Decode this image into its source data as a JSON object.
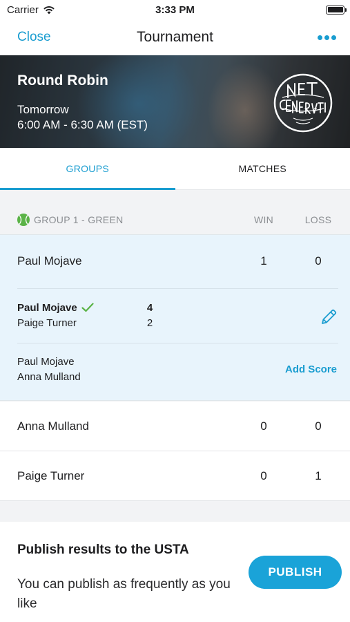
{
  "status_bar": {
    "carrier": "Carrier",
    "time": "3:33 PM"
  },
  "nav": {
    "close_label": "Close",
    "title": "Tournament"
  },
  "event": {
    "name": "Round Robin",
    "date": "Tomorrow",
    "time": "6:00 AM - 6:30 AM (EST)",
    "logo_text": "NET GENERATION"
  },
  "tabs": [
    {
      "label": "GROUPS",
      "active": true
    },
    {
      "label": "MATCHES",
      "active": false
    }
  ],
  "group": {
    "name": "GROUP 1 - GREEN",
    "win_label": "WIN",
    "loss_label": "LOSS",
    "color": "#5bb347"
  },
  "players": [
    {
      "name": "Paul Mojave",
      "win": "1",
      "loss": "0",
      "expanded": true
    },
    {
      "name": "Anna Mulland",
      "win": "0",
      "loss": "0"
    },
    {
      "name": "Paige Turner",
      "win": "0",
      "loss": "1"
    }
  ],
  "matches": [
    {
      "player1": "Paul Mojave",
      "player1_winner": true,
      "score1": "4",
      "player2": "Paige Turner",
      "score2": "2"
    },
    {
      "player1": "Paul Mojave",
      "player2": "Anna Mulland",
      "action_label": "Add Score"
    }
  ],
  "publish": {
    "title": "Publish results to the USTA",
    "description": "You can publish as frequently as you like",
    "button_label": "PUBLISH"
  },
  "colors": {
    "accent": "#1a9dd0",
    "check": "#5bb347",
    "expanded_bg": "#e8f4fc"
  }
}
